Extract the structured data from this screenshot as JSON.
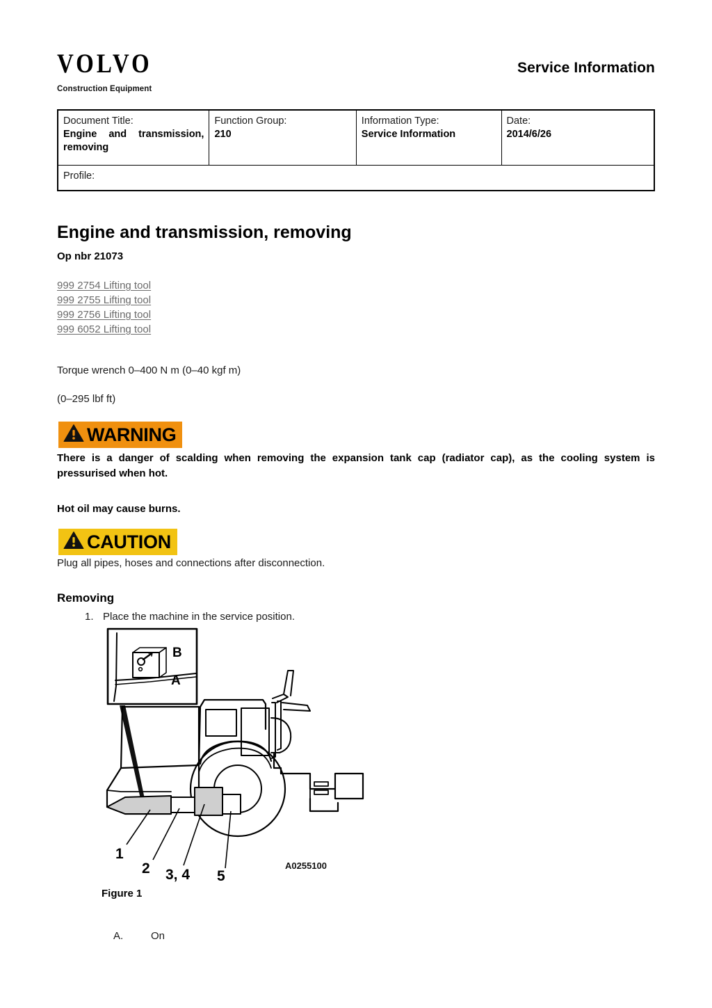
{
  "header": {
    "brand": "VOLVO",
    "brand_sub": "Construction Equipment",
    "title": "Service Information"
  },
  "info_table": {
    "columns": [
      {
        "label": "Document Title:",
        "value": "Engine and transmission, removing"
      },
      {
        "label": "Function Group:",
        "value": "210"
      },
      {
        "label": "Information Type:",
        "value": "Service Information"
      },
      {
        "label": "Date:",
        "value": "2014/6/26"
      }
    ],
    "profile_label": "Profile:",
    "profile_value": ""
  },
  "document": {
    "title": "Engine and transmission, removing",
    "op_nbr": "Op nbr 21073",
    "tools": [
      "999 2754 Lifting tool",
      "999 2755 Lifting tool",
      "999 2756 Lifting tool",
      "999 6052 Lifting tool"
    ],
    "torque_line_1": "Torque wrench 0–400 N m (0–40 kgf m)",
    "torque_line_2": "(0–295 lbf ft)"
  },
  "warning": {
    "word": "WARNING",
    "color": "#F0900F",
    "text": "There is a danger of scalding when removing the expansion tank cap (radiator cap), as the cooling system is pressurised when hot.",
    "secondary_text": "Hot oil may cause burns."
  },
  "caution": {
    "word": "CAUTION",
    "color": "#F2C313",
    "text": "Plug all pipes, hoses and connections after disconnection."
  },
  "procedure": {
    "section_title": "Removing",
    "steps": [
      {
        "number": "1.",
        "text": "Place the machine in the service position."
      }
    ]
  },
  "figure": {
    "caption": "Figure 1",
    "image_id": "A0255100",
    "inset_labels": [
      "B",
      "A"
    ],
    "callouts": [
      "1",
      "2",
      "3, 4",
      "5"
    ]
  },
  "legend": [
    {
      "key": "A.",
      "value": "On"
    }
  ]
}
